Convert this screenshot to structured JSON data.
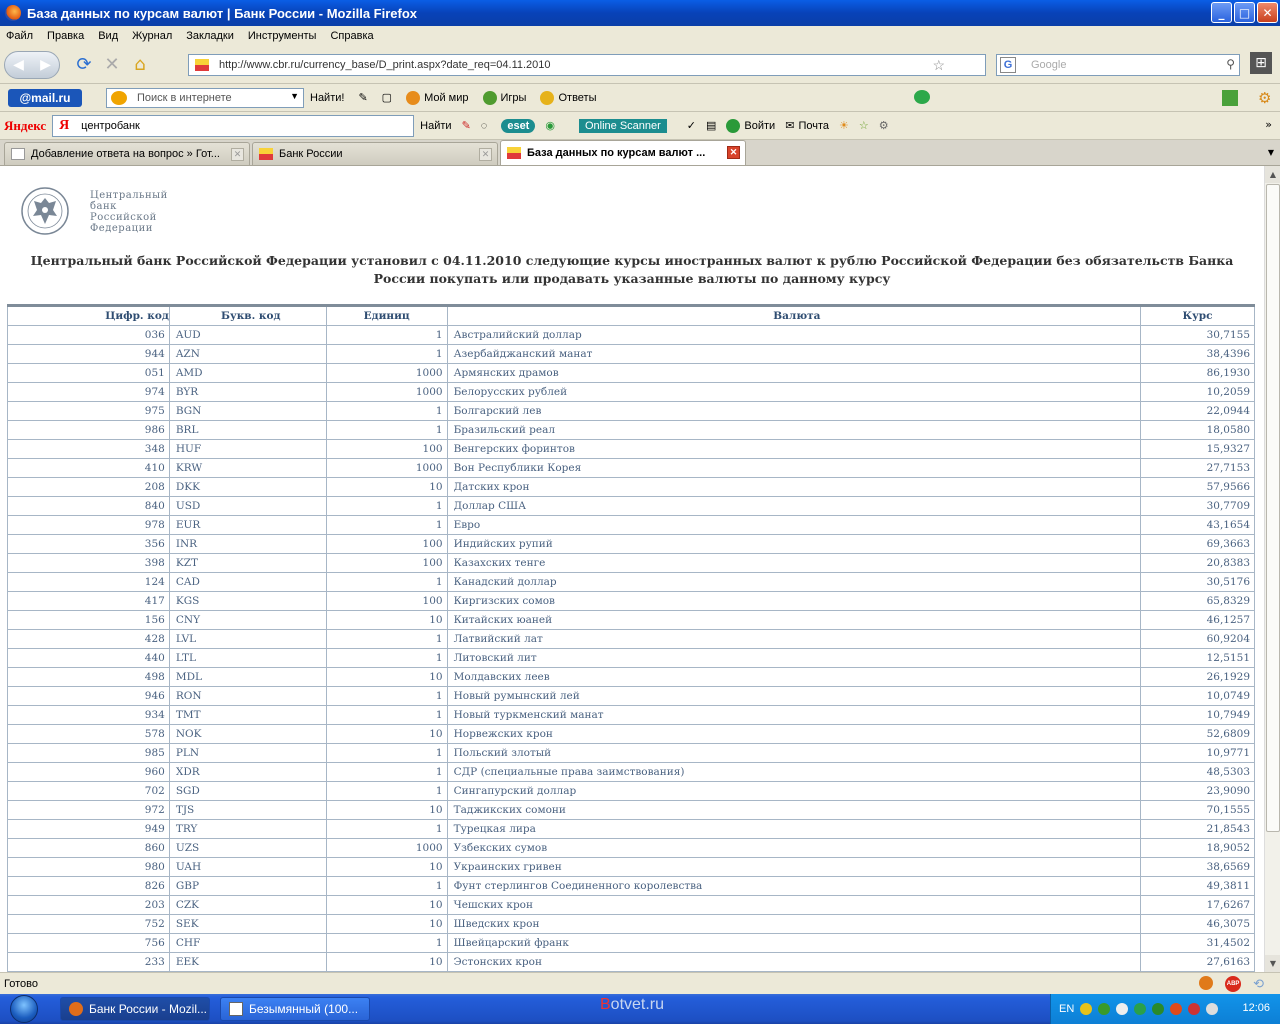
{
  "window": {
    "title": "База данных по курсам валют | Банк России - Mozilla Firefox",
    "minimize": "_",
    "maximize": "□",
    "close": "✕"
  },
  "menu": [
    "Файл",
    "Правка",
    "Вид",
    "Журнал",
    "Закладки",
    "Инструменты",
    "Справка"
  ],
  "nav": {
    "url": "http://www.cbr.ru/currency_base/D_print.aspx?date_req=04.11.2010",
    "search_placeholder": "Google"
  },
  "mailru_bar": {
    "logo": "@mail.ru",
    "search_placeholder": "Поиск в интернете",
    "find": "Найти!",
    "items": [
      "Мой мир",
      "Игры",
      "Ответы"
    ]
  },
  "yandex_bar": {
    "logo": "Яндекс",
    "query": "центробанк",
    "find": "Найти",
    "eset": "eset",
    "scanner": "Online Scanner",
    "login": "Войти",
    "mail": "Почта"
  },
  "tabs": [
    {
      "label": "Добавление ответа на вопрос » Гот...",
      "active": false
    },
    {
      "label": "Банк России",
      "active": false
    },
    {
      "label": "База данных по курсам валют ...",
      "active": true
    }
  ],
  "page": {
    "bank_name_lines": [
      "Центральный",
      "банк",
      "Российской",
      "Федерации"
    ],
    "heading": "Центральный банк Российской Федерации установил с 04.11.2010 следующие курсы иностранных валют к рублю Российской Федерации без обязательств Банка России покупать или продавать указанные валюты по данному курсу",
    "columns": [
      "Цифр. код",
      "Букв. код",
      "Единиц",
      "Валюта",
      "Курс"
    ],
    "rows": [
      [
        "036",
        "AUD",
        "1",
        "Австралийский доллар",
        "30,7155"
      ],
      [
        "944",
        "AZN",
        "1",
        "Азербайджанский манат",
        "38,4396"
      ],
      [
        "051",
        "AMD",
        "1000",
        "Армянских драмов",
        "86,1930"
      ],
      [
        "974",
        "BYR",
        "1000",
        "Белорусских рублей",
        "10,2059"
      ],
      [
        "975",
        "BGN",
        "1",
        "Болгарский лев",
        "22,0944"
      ],
      [
        "986",
        "BRL",
        "1",
        "Бразильский реал",
        "18,0580"
      ],
      [
        "348",
        "HUF",
        "100",
        "Венгерских форинтов",
        "15,9327"
      ],
      [
        "410",
        "KRW",
        "1000",
        "Вон Республики Корея",
        "27,7153"
      ],
      [
        "208",
        "DKK",
        "10",
        "Датских крон",
        "57,9566"
      ],
      [
        "840",
        "USD",
        "1",
        "Доллар США",
        "30,7709"
      ],
      [
        "978",
        "EUR",
        "1",
        "Евро",
        "43,1654"
      ],
      [
        "356",
        "INR",
        "100",
        "Индийских рупий",
        "69,3663"
      ],
      [
        "398",
        "KZT",
        "100",
        "Казахских тенге",
        "20,8383"
      ],
      [
        "124",
        "CAD",
        "1",
        "Канадский доллар",
        "30,5176"
      ],
      [
        "417",
        "KGS",
        "100",
        "Киргизских сомов",
        "65,8329"
      ],
      [
        "156",
        "CNY",
        "10",
        "Китайских юаней",
        "46,1257"
      ],
      [
        "428",
        "LVL",
        "1",
        "Латвийский лат",
        "60,9204"
      ],
      [
        "440",
        "LTL",
        "1",
        "Литовский лит",
        "12,5151"
      ],
      [
        "498",
        "MDL",
        "10",
        "Молдавских леев",
        "26,1929"
      ],
      [
        "946",
        "RON",
        "1",
        "Новый румынский лей",
        "10,0749"
      ],
      [
        "934",
        "TMT",
        "1",
        "Новый туркменский манат",
        "10,7949"
      ],
      [
        "578",
        "NOK",
        "10",
        "Норвежских крон",
        "52,6809"
      ],
      [
        "985",
        "PLN",
        "1",
        "Польский злотый",
        "10,9771"
      ],
      [
        "960",
        "XDR",
        "1",
        "СДР (специальные права заимствования)",
        "48,5303"
      ],
      [
        "702",
        "SGD",
        "1",
        "Сингапурский доллар",
        "23,9090"
      ],
      [
        "972",
        "TJS",
        "10",
        "Таджикских сомони",
        "70,1555"
      ],
      [
        "949",
        "TRY",
        "1",
        "Турецкая лира",
        "21,8543"
      ],
      [
        "860",
        "UZS",
        "1000",
        "Узбекских сумов",
        "18,9052"
      ],
      [
        "980",
        "UAH",
        "10",
        "Украинских гривен",
        "38,6569"
      ],
      [
        "826",
        "GBP",
        "1",
        "Фунт стерлингов Соединенного королевства",
        "49,3811"
      ],
      [
        "203",
        "CZK",
        "10",
        "Чешских крон",
        "17,6267"
      ],
      [
        "752",
        "SEK",
        "10",
        "Шведских крон",
        "46,3075"
      ],
      [
        "756",
        "CHF",
        "1",
        "Швейцарский франк",
        "31,4502"
      ],
      [
        "233",
        "EEK",
        "10",
        "Эстонских крон",
        "27,6163"
      ]
    ]
  },
  "status": {
    "text": "Готово"
  },
  "taskbar": {
    "items": [
      "Банк России - Mozil...",
      "Безымянный (100..."
    ],
    "watermark_prefix": "B",
    "watermark_rest": "otvet.ru",
    "lang": "EN",
    "clock": "12:06"
  }
}
